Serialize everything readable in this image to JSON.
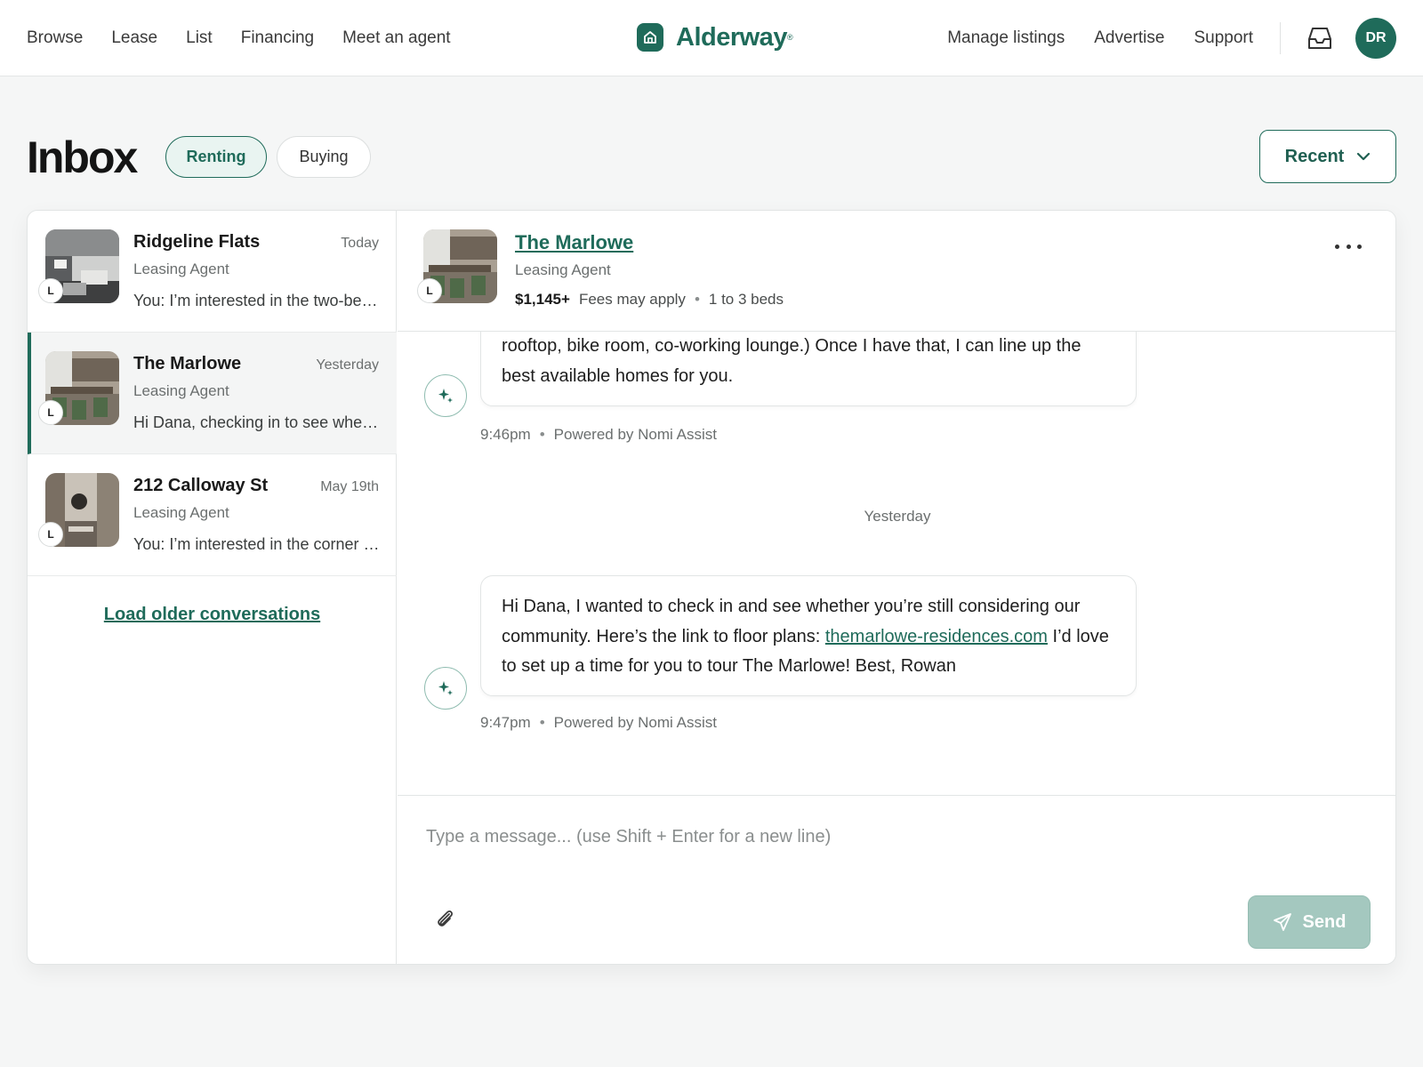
{
  "nav": {
    "left": [
      "Browse",
      "Lease",
      "List",
      "Financing",
      "Meet an agent"
    ],
    "brand": "Alderway",
    "brand_mark": "®",
    "right": [
      "Manage listings",
      "Advertise",
      "Support"
    ],
    "avatar_initials": "DR"
  },
  "page": {
    "title": "Inbox",
    "filters": {
      "renting": "Renting",
      "buying": "Buying"
    },
    "sort": "Recent"
  },
  "conversations": [
    {
      "name": "Ridgeline Flats",
      "date": "Today",
      "role": "Leasing Agent",
      "preview": "You: I’m interested in the two-bedroom unit",
      "badge": "L"
    },
    {
      "name": "The Marlowe",
      "date": "Yesterday",
      "role": "Leasing Agent",
      "preview": "Hi Dana, checking in to see whether you’re still considering",
      "badge": "L"
    },
    {
      "name": "212 Calloway St",
      "date": "May 19th",
      "role": "Leasing Agent",
      "preview": "You: I’m interested in the corner unit",
      "badge": "L"
    }
  ],
  "load_older": "Load older conversations",
  "detail": {
    "name": "The Marlowe",
    "role": "Leasing Agent",
    "badge": "L",
    "price": "$1,145+",
    "fees": "Fees may apply",
    "separator": "•",
    "beds": "1 to 3 beds"
  },
  "messages": {
    "first": {
      "text": "rooftop, bike room, co-working lounge.) Once I have that, I can line up the best available homes for you.",
      "time": "9:46pm",
      "separator": "•",
      "powered": "Powered by Nomi Assist"
    },
    "day_separator": "Yesterday",
    "second": {
      "text_before": "Hi Dana, I wanted to check in and see whether you’re still considering our community. Here’s the link to floor plans: ",
      "link": "themarlowe-residences.com",
      "text_after": " I’d love to set up a time for you to tour The Marlowe! Best, Rowan",
      "time": "9:47pm",
      "separator": "•",
      "powered": "Powered by Nomi Assist"
    }
  },
  "composer": {
    "placeholder": "Type a message... (use Shift + Enter for a new line)",
    "send": "Send"
  },
  "colors": {
    "brand": "#1f6b5a",
    "active_pill_bg": "#e9f4f1",
    "send_disabled": "#a4c8bf",
    "page_bg": "#f5f6f6"
  },
  "icons": [
    "home-icon",
    "inbox-icon",
    "chevron-down-icon",
    "more-icon",
    "sparkle-icon",
    "paperclip-icon",
    "send-icon"
  ]
}
